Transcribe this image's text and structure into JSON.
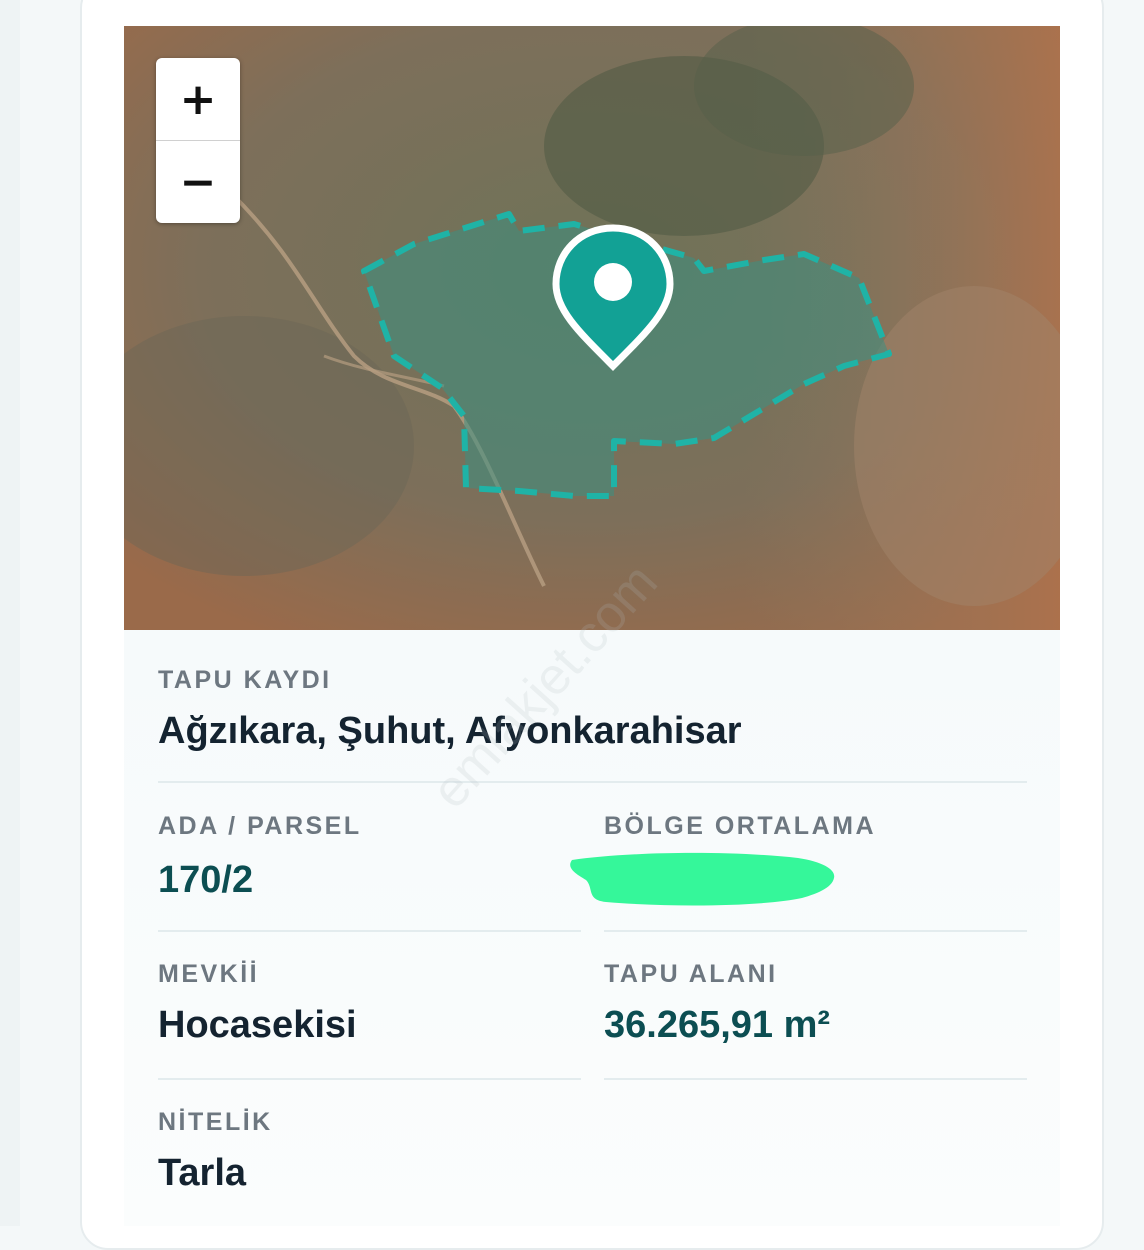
{
  "map": {
    "zoom_in": "+",
    "zoom_out": "−",
    "parcel_color": "#1fb3a6",
    "marker_color": "#12a195",
    "watermark": "emlakjet.com"
  },
  "deed": {
    "tapu_kaydi_label": "TAPU KAYDI",
    "tapu_kaydi_value": "Ağzıkara, Şuhut, Afyonkarahisar",
    "ada_parsel_label": "ADA / PARSEL",
    "ada_parsel_value": "170/2",
    "bolge_ortalama_label": "BÖLGE ORTALAMA",
    "bolge_ortalama_value": "",
    "mevkii_label": "MEVKİİ",
    "mevkii_value": "Hocasekisi",
    "tapu_alani_label": "TAPU ALANI",
    "tapu_alani_value": "36.265,91 m²",
    "nitelik_label": "NİTELİK",
    "nitelik_value": "Tarla"
  },
  "colors": {
    "accent_text": "#0c4e52",
    "redaction": "#35f79a"
  }
}
